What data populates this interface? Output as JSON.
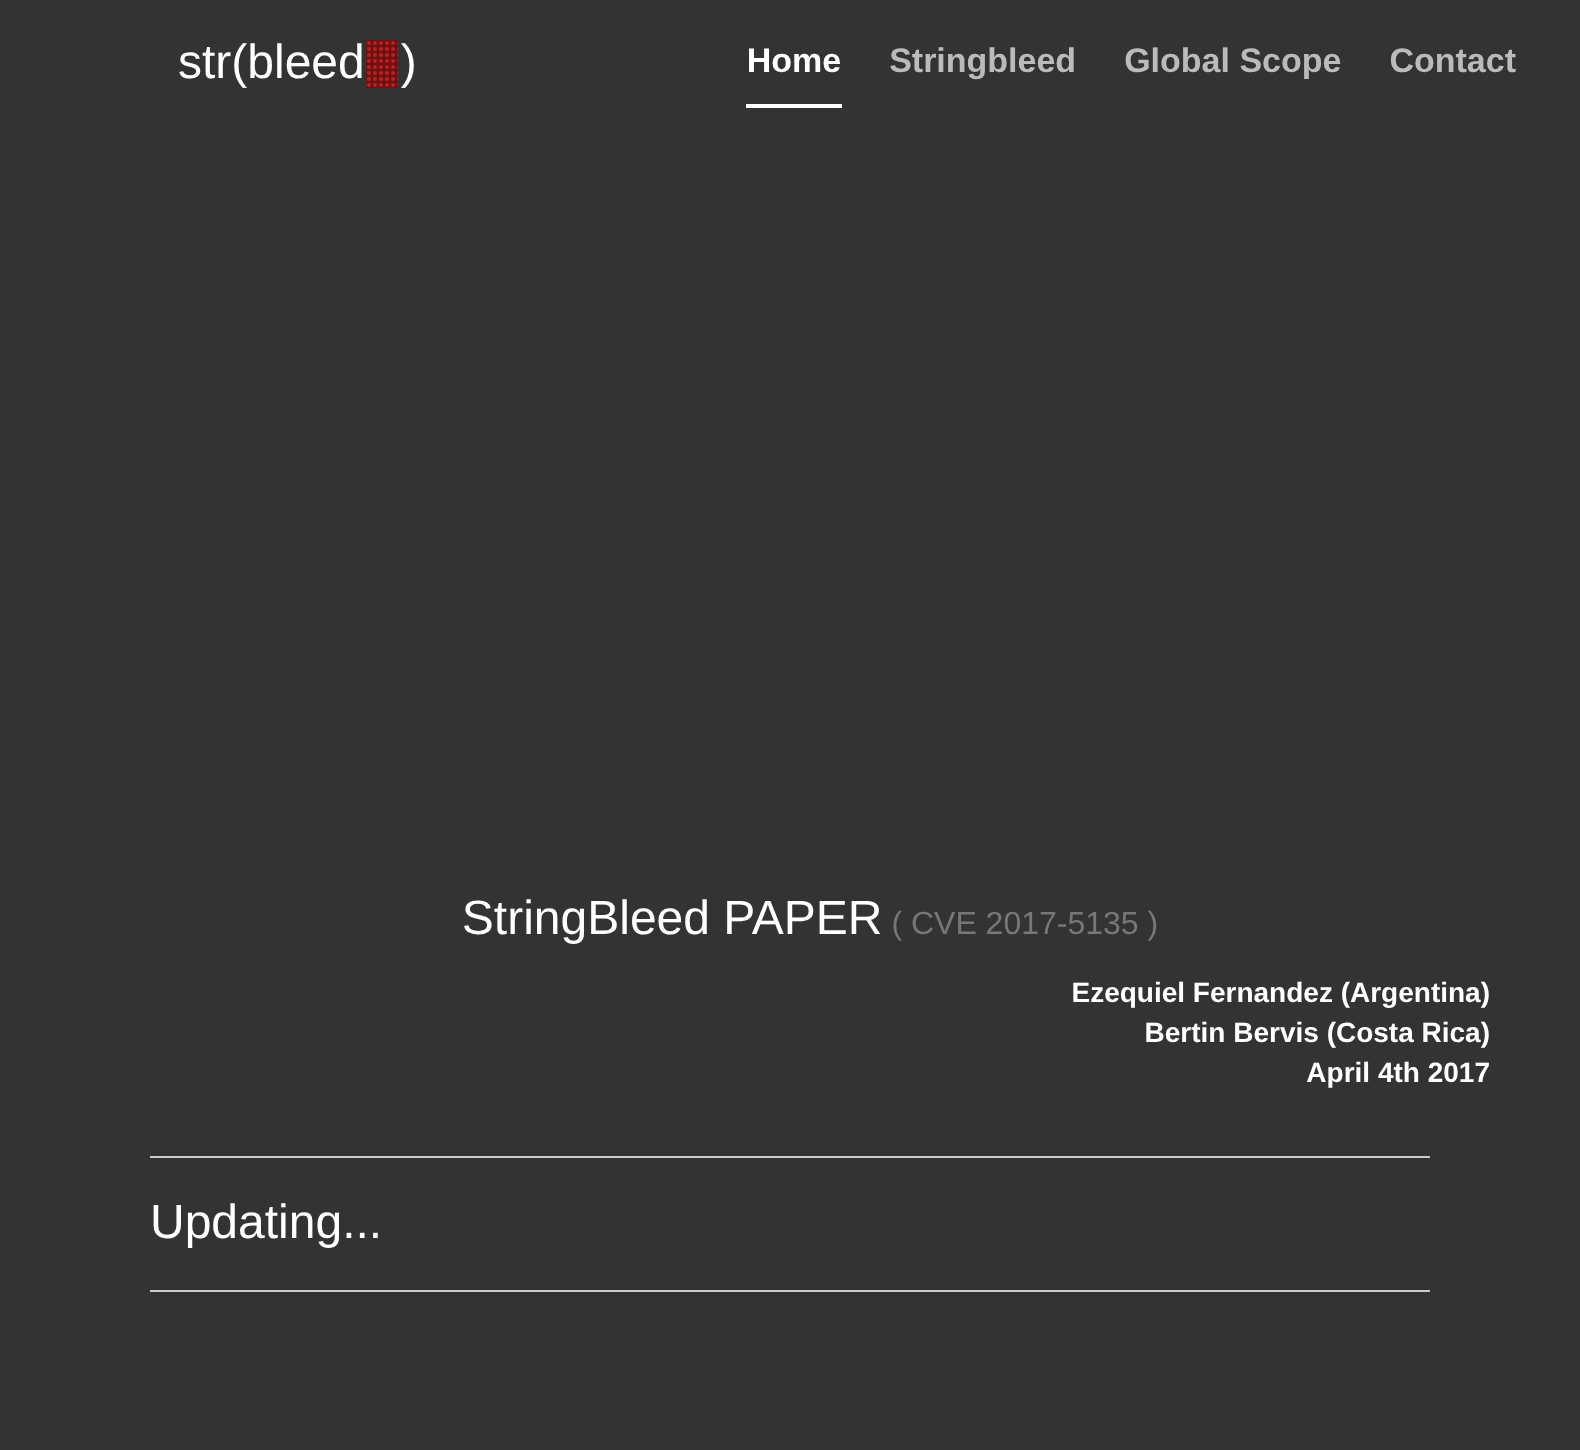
{
  "logo": {
    "prefix": "str(bleed",
    "suffix": ")"
  },
  "nav": [
    {
      "label": "Home",
      "selected": true
    },
    {
      "label": "Stringbleed",
      "selected": false
    },
    {
      "label": "Global Scope",
      "selected": false
    },
    {
      "label": "Contact",
      "selected": false
    }
  ],
  "paper": {
    "title": "StringBleed PAPER",
    "cve": "( CVE 2017-5135 )",
    "authors": [
      "Ezequiel Fernandez (Argentina)",
      "Bertin Bervis (Costa Rica)"
    ],
    "date": "April 4th 2017"
  },
  "status": "Updating..."
}
